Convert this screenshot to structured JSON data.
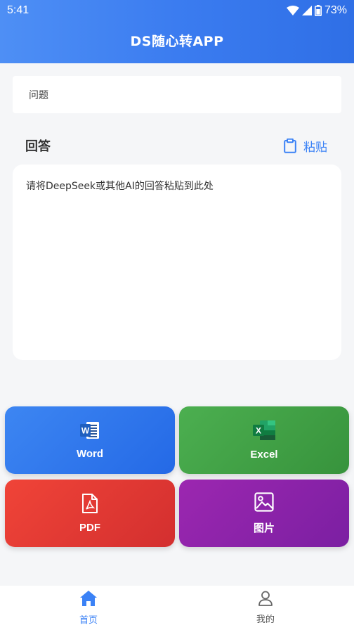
{
  "status_bar": {
    "time": "5:41",
    "battery": "73%"
  },
  "header": {
    "title": "DS随心转APP"
  },
  "question": {
    "label": "问题"
  },
  "answer": {
    "label": "回答",
    "paste_label": "粘贴",
    "placeholder": "请将DeepSeek或其他AI的回答粘贴到此处"
  },
  "actions": [
    {
      "label": "Word",
      "icon": "word-icon",
      "color": "#2f77ee"
    },
    {
      "label": "Excel",
      "icon": "excel-icon",
      "color": "#43a047"
    },
    {
      "label": "PDF",
      "icon": "pdf-icon",
      "color": "#e53935"
    },
    {
      "label": "图片",
      "icon": "image-icon",
      "color": "#8e24aa"
    }
  ],
  "nav": [
    {
      "label": "首页",
      "icon": "home-icon",
      "active": true
    },
    {
      "label": "我的",
      "icon": "user-icon",
      "active": false
    }
  ],
  "colors": {
    "accent": "#3b82f6",
    "header_start": "#4e8ff5",
    "header_end": "#2f6fe6"
  }
}
